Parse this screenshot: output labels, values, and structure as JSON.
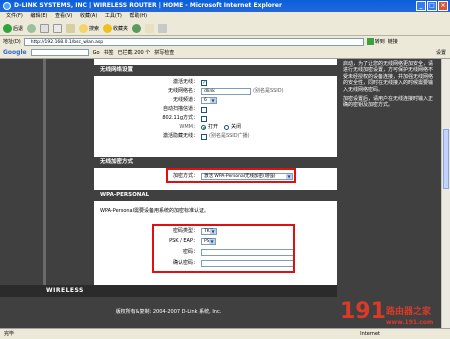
{
  "window": {
    "title": "D-LINK SYSTEMS, INC | WIRELESS ROUTER | HOME - Microsoft Internet Explorer",
    "buttons": [
      "_",
      "□",
      "×"
    ]
  },
  "menubar": [
    "文件(F)",
    "编辑(E)",
    "查看(V)",
    "收藏(A)",
    "工具(T)",
    "帮助(H)"
  ],
  "toolbar": {
    "back": "后退",
    "search": "搜索",
    "favorites": "收藏夹"
  },
  "address": {
    "label": "地址(D)",
    "url": "http://192.168.0.1/bsc_wlan.asp",
    "go": "转到",
    "links": "链接"
  },
  "googlebar": {
    "logo": "Google",
    "g": "G",
    "go": "Go",
    "bookmarks": "书签",
    "blocked": "已拦截 200 个",
    "check": "拼写检查",
    "options": "设置"
  },
  "wireless_settings": {
    "heading": "无线网络设置",
    "rows": [
      {
        "label": "激活无线：",
        "type": "checkbox",
        "checked": true
      },
      {
        "label": "无线网络名：",
        "type": "text",
        "value": "dlink",
        "note": "(别名是SSID)"
      },
      {
        "label": "无线频道：",
        "type": "select",
        "value": "6"
      },
      {
        "label": "自动扫描信道：",
        "type": "checkbox",
        "checked": false
      },
      {
        "label": "802.11g方式：",
        "type": "checkbox",
        "checked": false
      },
      {
        "label": "WMM：",
        "type": "radio",
        "opt1": "打开",
        "opt2": "关闭"
      },
      {
        "label": "激活隐藏无线：",
        "type": "checkbox",
        "checked": false,
        "note": "(别名是SSID广播)"
      }
    ]
  },
  "encryption": {
    "heading": "无线加密方式",
    "label": "加密方式：",
    "value": "激活 WPA-Personal无线加密(增强)"
  },
  "wpa": {
    "heading": "WPA-PERSONAL",
    "desc": "WPA-Personal需要设备用系统的加密标准认证。",
    "rows": [
      {
        "label": "密码类型：",
        "type": "select",
        "value": "TKIP"
      },
      {
        "label": "PSK / EAP：",
        "type": "select",
        "value": "PSK"
      },
      {
        "label": "密码：",
        "type": "text",
        "value": ""
      },
      {
        "label": "确认密码：",
        "type": "text",
        "value": ""
      }
    ]
  },
  "help": {
    "p1": "启动，为了让您的无线网络更加安全，请进行无线加密设置，方可保护无线网络不受未经授权的设备连接，并加强无线网络的安全性，同时在无线接入的时候需要输入无线网络密码。",
    "p2": "加密设置后，请用户在无线连接时输入正确的密钥及加密方式。"
  },
  "footer": {
    "brand": "WIRELESS",
    "copyright": "版权所有&复制: 2004-2007 D-Link 系统, Inc."
  },
  "status": {
    "left": "完毕",
    "right": "Internet"
  },
  "watermark": {
    "num": "191",
    "sub": "路由器之家",
    "url": "www.191.com"
  },
  "colors": {
    "title_blue": "#0a5fdc",
    "page_dark": "#404040",
    "highlight_red": "#e01010",
    "check_green": "#21a121"
  }
}
